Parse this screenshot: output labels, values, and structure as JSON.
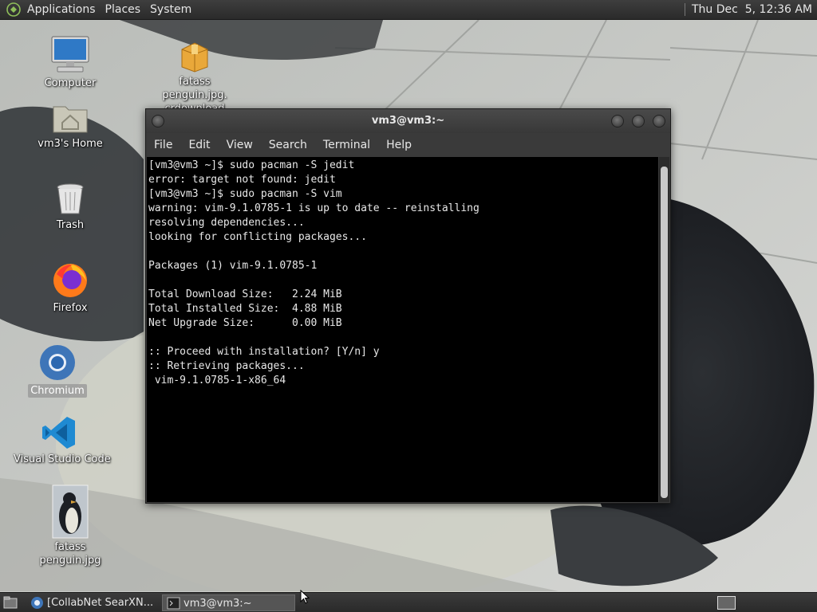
{
  "top_panel": {
    "menus": [
      "Applications",
      "Places",
      "System"
    ],
    "clock": "Thu Dec  5, 12:36 AM"
  },
  "desktop_icons": [
    {
      "label": "Computer",
      "icon": "computer-icon"
    },
    {
      "label": "fatass penguin.jpg.\ncrdownload",
      "icon": "package-icon"
    },
    {
      "label": "vm3's Home",
      "icon": "home-folder-icon"
    },
    {
      "label": "Trash",
      "icon": "trash-icon"
    },
    {
      "label": "Firefox",
      "icon": "firefox-icon"
    },
    {
      "label": "Chromium",
      "icon": "chromium-icon",
      "selected": true
    },
    {
      "label": "Visual Studio Code",
      "icon": "vscode-icon"
    },
    {
      "label": "fatass penguin.jpg",
      "icon": "penguin-image-icon"
    }
  ],
  "terminal": {
    "title": "vm3@vm3:~",
    "menu": [
      "File",
      "Edit",
      "View",
      "Search",
      "Terminal",
      "Help"
    ],
    "lines": [
      "[vm3@vm3 ~]$ sudo pacman -S jedit",
      "error: target not found: jedit",
      "[vm3@vm3 ~]$ sudo pacman -S vim",
      "warning: vim-9.1.0785-1 is up to date -- reinstalling",
      "resolving dependencies...",
      "looking for conflicting packages...",
      "",
      "Packages (1) vim-9.1.0785-1",
      "",
      "Total Download Size:   2.24 MiB",
      "Total Installed Size:  4.88 MiB",
      "Net Upgrade Size:      0.00 MiB",
      "",
      ":: Proceed with installation? [Y/n] y",
      ":: Retrieving packages...",
      " vim-9.1.0785-1-x86_64"
    ]
  },
  "taskbar": {
    "tasks": [
      {
        "label": "[CollabNet SearXN...",
        "icon": "browser-icon",
        "active": false
      },
      {
        "label": "vm3@vm3:~",
        "icon": "terminal-icon",
        "active": true
      }
    ]
  }
}
